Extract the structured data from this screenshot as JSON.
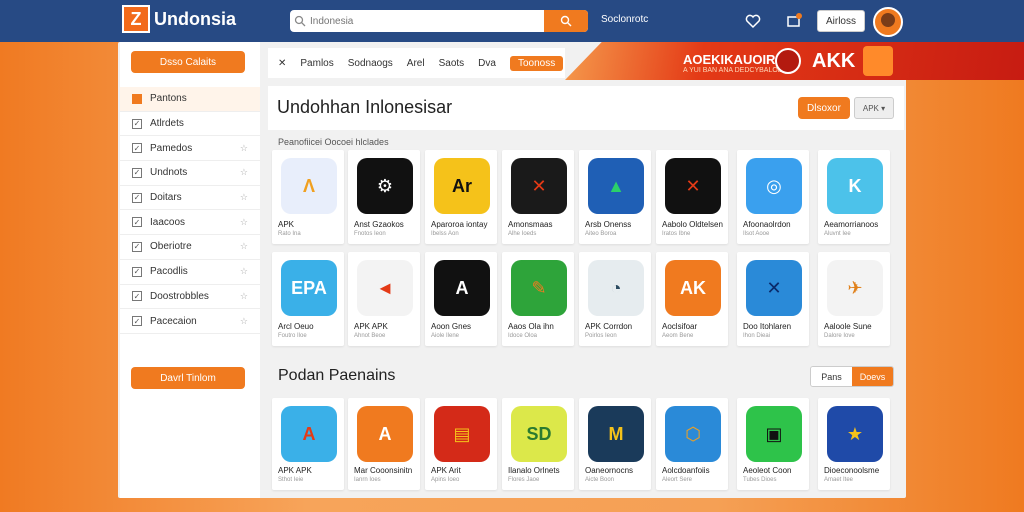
{
  "app": {
    "logo_text": "Undonsia",
    "search_placeholder": "Indonesia",
    "topnav_link": "Soclonrotc",
    "signin_label": "Airloss"
  },
  "sidebar": {
    "top_button": "Dsso Calaits",
    "bottom_button": "Davrl Tinlom",
    "items": [
      {
        "label": "Pantons",
        "active": true
      },
      {
        "label": "Atlrdets",
        "active": false
      },
      {
        "label": "Pamedos",
        "active": false
      },
      {
        "label": "Undnots",
        "active": false
      },
      {
        "label": "Doitars",
        "active": false
      },
      {
        "label": "Iaacoos",
        "active": false
      },
      {
        "label": "Oberiotre",
        "active": false
      },
      {
        "label": "Pacodlis",
        "active": false
      },
      {
        "label": "Doostrobbles",
        "active": false
      },
      {
        "label": "Pacecaion",
        "active": false
      }
    ]
  },
  "tabs": [
    "Pamlos",
    "Sodnaogs",
    "Arel",
    "Saots",
    "Dva",
    "Toonoss"
  ],
  "banner": {
    "title": "AOEKIKAUOIR",
    "subtitle": "A YUI BAN ANA DEDCYBALOD",
    "brand": "AKK"
  },
  "main": {
    "title": "Undohhan Inlonesisar",
    "discover_button": "Dlsoxor",
    "select_label": "APK ▾",
    "section_subtitle": "Peanofiicei Oocoei hlclades",
    "section2_title": "Podan Paenains",
    "seg_left": "Pans",
    "seg_right": "Doevs"
  },
  "row1": [
    {
      "name": "APK",
      "meta": "Rato Ina",
      "icon": "Λ",
      "bg": "#e8eefb",
      "fg": "#f0a020"
    },
    {
      "name": "Anst Gzaokos",
      "meta": "Fnotos Ieon",
      "icon": "⚙",
      "bg": "#111111",
      "fg": "#ffffff"
    },
    {
      "name": "Aparoroa iontay",
      "meta": "Ibelss Aon",
      "icon": "Ar",
      "bg": "#f5c21a",
      "fg": "#111111"
    },
    {
      "name": "Amonsmaas",
      "meta": "Alhe Ioeds",
      "icon": "✕",
      "bg": "#1a1a1a",
      "fg": "#e43a16"
    },
    {
      "name": "Arsb Onenss",
      "meta": "Aiteo Boroa",
      "icon": "▲",
      "bg": "#1f5fb5",
      "fg": "#2bd16a"
    },
    {
      "name": "Aabolo Oldtelsen",
      "meta": "Iratos Ibne",
      "icon": "✕",
      "bg": "#111111",
      "fg": "#e43a16"
    },
    {
      "name": "Afoonaolrdon",
      "meta": "Ilsot Aooe",
      "icon": "◎",
      "bg": "#3aa0ee",
      "fg": "#ffffff"
    },
    {
      "name": "Aeamorrianoos",
      "meta": "Aluvnt Iee",
      "icon": "K",
      "bg": "#4cc2ea",
      "fg": "#ffffff"
    }
  ],
  "row2": [
    {
      "name": "Arcl Oeuo",
      "meta": "Foutro Iloe",
      "icon": "EPA",
      "bg": "#3ab0e8",
      "fg": "#ffffff"
    },
    {
      "name": "APK APK",
      "meta": "Ahnot Beoe",
      "icon": "◄",
      "bg": "#f3f3f3",
      "fg": "#e43a16"
    },
    {
      "name": "Aoon Gnes",
      "meta": "Aiole Ilene",
      "icon": "A",
      "bg": "#111111",
      "fg": "#ffffff"
    },
    {
      "name": "Aaos Ola ihn",
      "meta": "Idoce Oloa",
      "icon": "✎",
      "bg": "#2ea43a",
      "fg": "#f07a1f"
    },
    {
      "name": "APK Corrdon",
      "meta": "Poirlos Ieon",
      "icon": "◔",
      "bg": "#e6ecef",
      "fg": "#2a4a60"
    },
    {
      "name": "Aoclsifoar",
      "meta": "Aeom Bene",
      "icon": "AK",
      "bg": "#f07a1f",
      "fg": "#ffffff"
    },
    {
      "name": "Doo Itohlaren",
      "meta": "Ihon Dieai",
      "icon": "✕",
      "bg": "#2a8ad8",
      "fg": "#0a2a6a"
    },
    {
      "name": "Aaloole Sune",
      "meta": "Dalore Iove",
      "icon": "✈",
      "bg": "#f3f3f3",
      "fg": "#e0801a"
    }
  ],
  "row3": [
    {
      "name": "APK APK",
      "meta": "Sthot Ieie",
      "icon": "A",
      "bg": "#3ab0e8",
      "fg": "#e43a16"
    },
    {
      "name": "Mar Cooonsinitn",
      "meta": "Ianrn Ioes",
      "icon": "A",
      "bg": "#f07a1f",
      "fg": "#ffffff"
    },
    {
      "name": "APK Arit",
      "meta": "Apins Ioeo",
      "icon": "▤",
      "bg": "#d42a18",
      "fg": "#f5c21a"
    },
    {
      "name": "Ilanalo Orlnets",
      "meta": "Flores Jaoe",
      "icon": "SD",
      "bg": "#dce84a",
      "fg": "#2a7a30"
    },
    {
      "name": "Oaneornocns",
      "meta": "Aicte Boon",
      "icon": "M",
      "bg": "#1a3a5a",
      "fg": "#f5c21a"
    },
    {
      "name": "Aolcdoanfoiis",
      "meta": "Aleort Sere",
      "icon": "⬡",
      "bg": "#2a8ad8",
      "fg": "#f0a020"
    },
    {
      "name": "Aeoleot Coon",
      "meta": "Tubes Dioes",
      "icon": "▣",
      "bg": "#2ec34a",
      "fg": "#111111"
    },
    {
      "name": "Dioeconoolsme",
      "meta": "Amaet Itee",
      "icon": "★",
      "bg": "#1f4aa8",
      "fg": "#f5c21a"
    }
  ]
}
